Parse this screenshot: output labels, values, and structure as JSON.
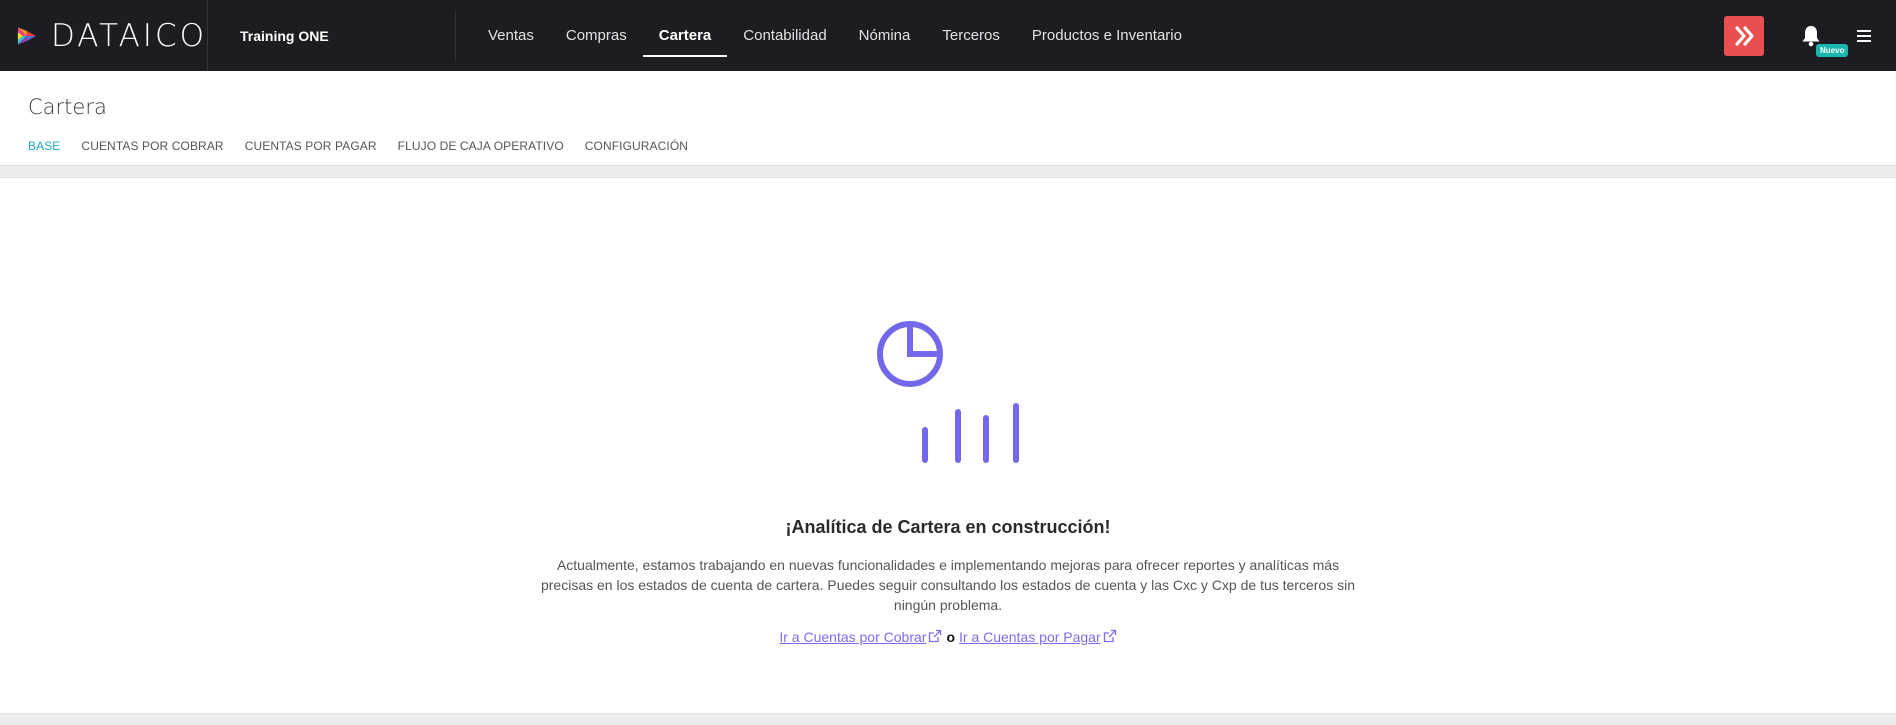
{
  "brand": {
    "name": "DATAICO"
  },
  "company": {
    "name": "Training ONE"
  },
  "nav": {
    "items": [
      {
        "label": "Ventas"
      },
      {
        "label": "Compras"
      },
      {
        "label": "Cartera",
        "active": true
      },
      {
        "label": "Contabilidad"
      },
      {
        "label": "Nómina"
      },
      {
        "label": "Terceros"
      },
      {
        "label": "Productos e Inventario"
      }
    ]
  },
  "notifications": {
    "badge": "Nuevo"
  },
  "page": {
    "title": "Cartera",
    "tabs": [
      {
        "label": "BASE",
        "active": true
      },
      {
        "label": "CUENTAS POR COBRAR"
      },
      {
        "label": "CUENTAS POR PAGAR"
      },
      {
        "label": "FLUJO DE CAJA OPERATIVO"
      },
      {
        "label": "CONFIGURACIÓN"
      }
    ]
  },
  "empty_state": {
    "title": "¡Analítica de Cartera en construcción!",
    "description": "Actualmente, estamos trabajando en nuevas funcionalidades e implementando mejoras para ofrecer reportes y analíticas más precisas en los estados de cuenta de cartera. Puedes seguir consultando los estados de cuenta y las Cxc y Cxp de tus terceros sin ningún problema.",
    "link_receivable": "Ir a Cuentas por Cobrar",
    "or_label": "o",
    "link_payable": "Ir a Cuentas por Pagar"
  },
  "colors": {
    "topbar": "#1c1d20",
    "accent": "#1da7c4",
    "illustration": "#7468ea",
    "link": "#7b6cf0",
    "badge": "#19b7b0",
    "extension": "#e94f4f"
  }
}
